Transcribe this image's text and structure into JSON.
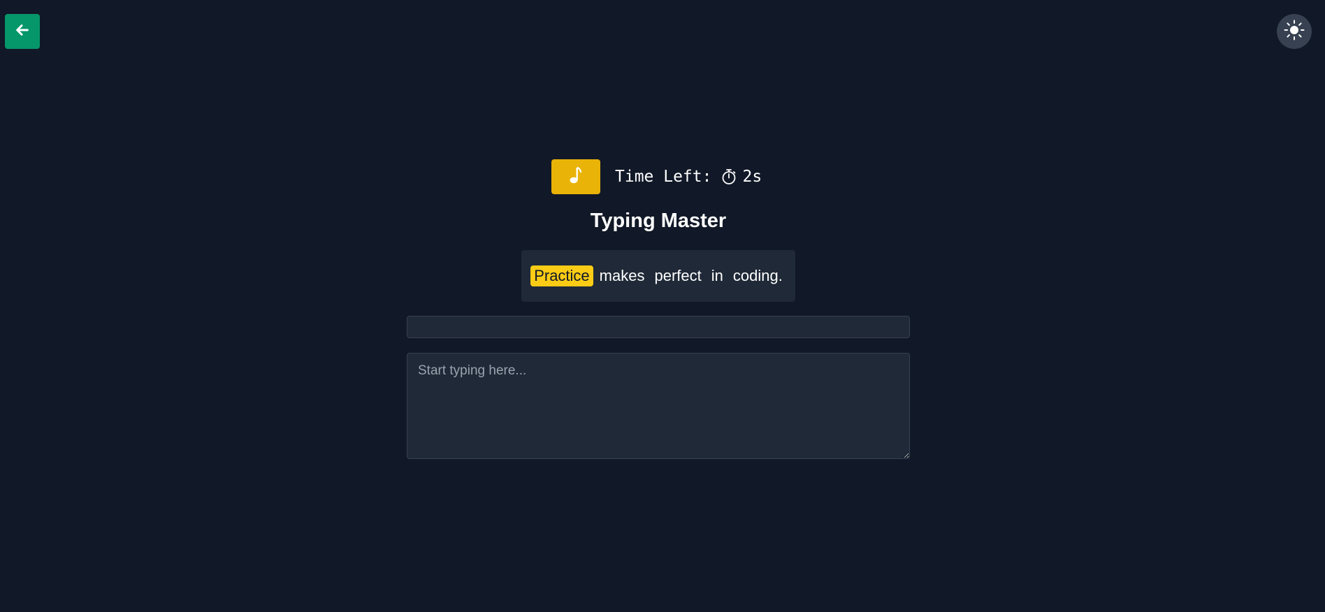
{
  "header": {
    "back_icon": "arrow-left-icon",
    "theme_icon": "sun-icon"
  },
  "controls": {
    "music_icon": "music-note-icon",
    "timer_label": "Time Left:",
    "timer_icon": "stopwatch-icon",
    "timer_value": "2s"
  },
  "title": "Typing Master",
  "sentence": {
    "words": [
      "Practice",
      "makes",
      "perfect",
      "in",
      "coding."
    ],
    "current_index": 0
  },
  "progress": {
    "fraction": 0
  },
  "typing_area": {
    "value": "",
    "placeholder": "Start typing here..."
  },
  "colors": {
    "background": "#111827",
    "panel": "#1f2937",
    "back_button": "#059669",
    "music_button": "#eab308",
    "highlight": "#facc15",
    "theme_button": "#374151"
  }
}
